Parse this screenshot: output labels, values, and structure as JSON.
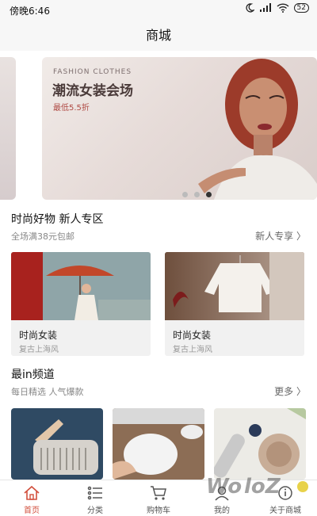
{
  "status": {
    "time": "傍晚6:46",
    "battery": "52"
  },
  "header": {
    "title": "商城"
  },
  "banner": {
    "tag": "FASHION CLOTHES",
    "headline": "潮流女装会场",
    "subline": "最低5.5折"
  },
  "section1": {
    "title": "时尚好物 新人专区",
    "subtitle": "全场满38元包邮",
    "more": "新人专享 〉",
    "cards": [
      {
        "name": "时尚女装",
        "desc": "复古上海风"
      },
      {
        "name": "时尚女装",
        "desc": "复古上海风"
      }
    ]
  },
  "section2": {
    "title": "最in频道",
    "subtitle": "每日精选 人气爆款",
    "more": "更多 〉"
  },
  "tabbar": {
    "items": [
      {
        "label": "首页",
        "icon": "home-icon",
        "active": true
      },
      {
        "label": "分类",
        "icon": "list-icon",
        "active": false
      },
      {
        "label": "购物车",
        "icon": "cart-icon",
        "active": false
      },
      {
        "label": "我的",
        "icon": "user-icon",
        "active": false
      },
      {
        "label": "关于商城",
        "icon": "info-icon",
        "active": false
      }
    ]
  },
  "colors": {
    "accent": "#d24f3c",
    "background": "#f4f4f4"
  }
}
